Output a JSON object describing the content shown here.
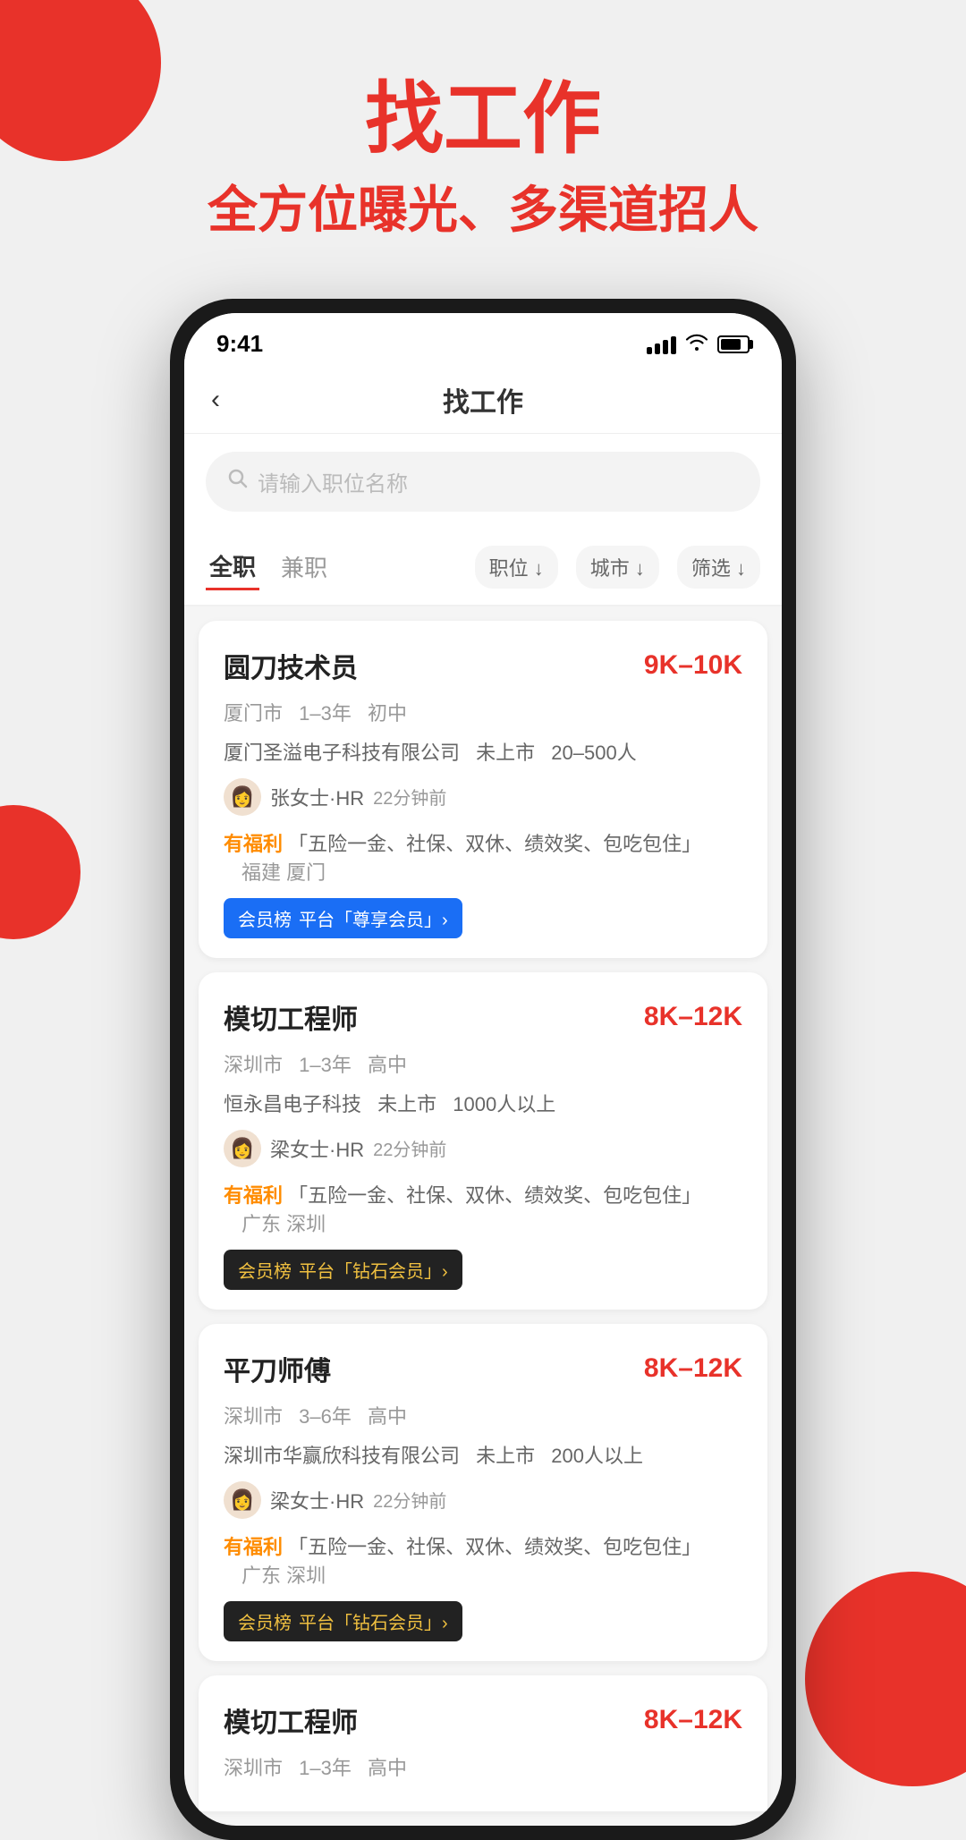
{
  "hero": {
    "title": "找工作",
    "subtitle": "全方位曝光、多渠道招人"
  },
  "statusBar": {
    "time": "9:41",
    "signal": [
      4,
      8,
      12,
      16,
      20
    ],
    "wifiSymbol": "▲",
    "battery": "■"
  },
  "navBar": {
    "backIcon": "‹",
    "title": "找工作"
  },
  "searchBar": {
    "icon": "○",
    "placeholder": "请输入职位名称"
  },
  "filterBar": {
    "tabs": [
      {
        "label": "全职",
        "active": true
      },
      {
        "label": "兼职",
        "active": false
      }
    ],
    "buttons": [
      {
        "label": "职位 ↓"
      },
      {
        "label": "城市 ↓"
      },
      {
        "label": "筛选 ↓"
      }
    ]
  },
  "jobs": [
    {
      "title": "圆刀技术员",
      "salary": "9K–10K",
      "city": "厦门市",
      "experience": "1–3年",
      "education": "初中",
      "company": "厦门圣溢电子科技有限公司",
      "companyStatus": "未上市",
      "companySize": "20–500人",
      "hrAvatar": "👩",
      "hrName": "张女士·HR",
      "hrTime": "22分钟前",
      "welfareLabel": "有福利",
      "welfareText": "「五险一金、社保、双休、绩效奖、包吃包住」",
      "welfareLocation": "福建 厦门",
      "badgeType": "blue",
      "badgePrefix": "会员榜",
      "badgeText": "平台「尊享会员」›"
    },
    {
      "title": "模切工程师",
      "salary": "8K–12K",
      "city": "深圳市",
      "experience": "1–3年",
      "education": "高中",
      "company": "恒永昌电子科技",
      "companyStatus": "未上市",
      "companySize": "1000人以上",
      "hrAvatar": "👩",
      "hrName": "梁女士·HR",
      "hrTime": "22分钟前",
      "welfareLabel": "有福利",
      "welfareText": "「五险一金、社保、双休、绩效奖、包吃包住」",
      "welfareLocation": "广东 深圳",
      "badgeType": "dark",
      "badgePrefix": "会员榜",
      "badgeText": "平台「钻石会员」›"
    },
    {
      "title": "平刀师傅",
      "salary": "8K–12K",
      "city": "深圳市",
      "experience": "3–6年",
      "education": "高中",
      "company": "深圳市华赢欣科技有限公司",
      "companyStatus": "未上市",
      "companySize": "200人以上",
      "hrAvatar": "👩",
      "hrName": "梁女士·HR",
      "hrTime": "22分钟前",
      "welfareLabel": "有福利",
      "welfareText": "「五险一金、社保、双休、绩效奖、包吃包住」",
      "welfareLocation": "广东 深圳",
      "badgeType": "dark",
      "badgePrefix": "会员榜",
      "badgeText": "平台「钻石会员」›"
    },
    {
      "title": "模切工程师",
      "salary": "8K–12K",
      "city": "深圳市",
      "experience": "1–3年",
      "education": "高中",
      "company": "",
      "companyStatus": "",
      "companySize": "",
      "hrAvatar": "",
      "hrName": "",
      "hrTime": "",
      "welfareLabel": "",
      "welfareText": "",
      "welfareLocation": "",
      "badgeType": "",
      "badgePrefix": "",
      "badgeText": ""
    }
  ]
}
